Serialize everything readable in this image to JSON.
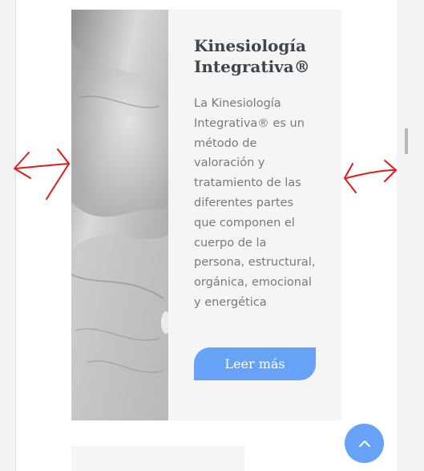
{
  "card": {
    "title": "Kinesiología Integrativa®",
    "description": "La Kinesiología Integrativa® es un método de valoración y tratamiento de las diferentes partes que componen el cuerpo de la persona, estructural, orgánica, emocional y energética",
    "button_label": "Leer más",
    "image_subject": "hands-black-and-white-photo"
  },
  "scroll_top_button": {
    "icon": "chevron-up-icon"
  },
  "annotations": {
    "color": "#e01b1b",
    "icon": "double-arrow"
  },
  "colors": {
    "accent": "#66a3f6",
    "title": "#3d454d",
    "text": "#7a7a7a",
    "card_bg": "#f5f5f5"
  }
}
